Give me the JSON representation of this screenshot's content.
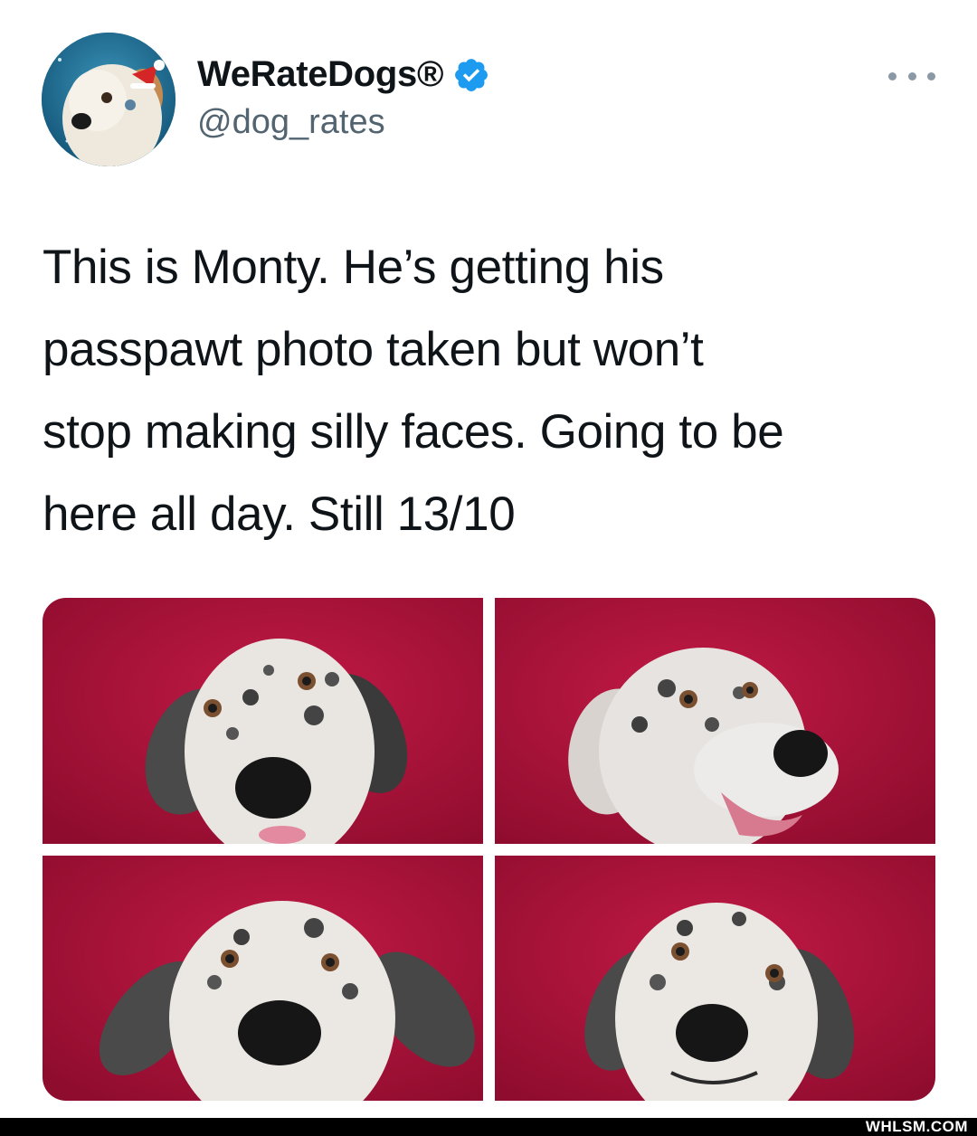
{
  "author": {
    "display_name": "WeRateDogs®",
    "handle": "@dog_rates",
    "verified": true
  },
  "icons": {
    "verified": "verified-badge-icon",
    "more": "more-options-icon"
  },
  "tweet": {
    "text": "This is Monty. He’s getting his\npasspawt photo taken but won’t\nstop making silly faces. Going to be\nhere all day. Still 13/10"
  },
  "media": {
    "photo_count": 4
  },
  "colors": {
    "verified_blue": "#1d9bf0",
    "photo_background": "#a8123a"
  },
  "watermark": "WHLSM.COM"
}
